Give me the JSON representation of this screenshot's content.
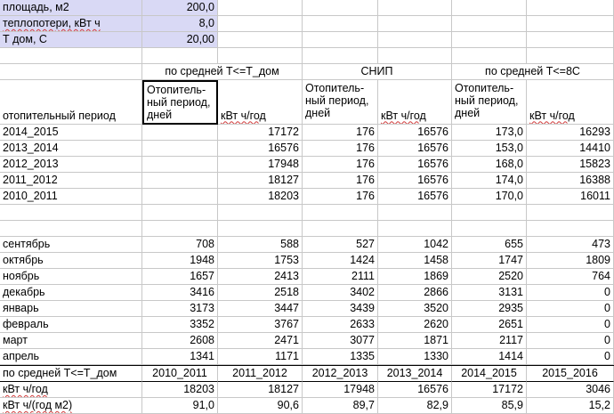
{
  "params": [
    {
      "label": "площадь, м2",
      "value": "200,0"
    },
    {
      "label": "теплопотери, кВт ч",
      "value": "8,0"
    },
    {
      "label": "Т дом, С",
      "value": "20,00"
    }
  ],
  "group_headers": [
    "по средней Т<=Т_дом",
    "СНИП",
    "по средней Т<=8С"
  ],
  "col_headers": {
    "period": "отопительный период",
    "days": "Отопитель-ный период, дней",
    "kwh": "кВт ч/год"
  },
  "seasons": [
    [
      "2014_2015",
      "",
      "17172",
      "176",
      "16576",
      "173,0",
      "16293"
    ],
    [
      "2013_2014",
      "",
      "16576",
      "176",
      "16576",
      "153,0",
      "14410"
    ],
    [
      "2012_2013",
      "",
      "17948",
      "176",
      "16576",
      "168,0",
      "15823"
    ],
    [
      "2011_2012",
      "",
      "18127",
      "176",
      "16576",
      "174,0",
      "16388"
    ],
    [
      "2010_2011",
      "",
      "18203",
      "176",
      "16576",
      "170,0",
      "16011"
    ]
  ],
  "months": [
    [
      "сентябрь",
      "708",
      "588",
      "527",
      "1042",
      "655",
      "473"
    ],
    [
      "октябрь",
      "1948",
      "1753",
      "1424",
      "1458",
      "1747",
      "1809"
    ],
    [
      "ноябрь",
      "1657",
      "2413",
      "2111",
      "1869",
      "2520",
      "764"
    ],
    [
      "декабрь",
      "3416",
      "2518",
      "3402",
      "2866",
      "3131",
      "0"
    ],
    [
      "январь",
      "3173",
      "3447",
      "3439",
      "3520",
      "2935",
      "0"
    ],
    [
      "февраль",
      "3352",
      "3767",
      "2633",
      "2620",
      "2651",
      "0"
    ],
    [
      "март",
      "2608",
      "2471",
      "3077",
      "1871",
      "2117",
      "0"
    ],
    [
      "апрель",
      "1341",
      "1171",
      "1335",
      "1330",
      "1414",
      "0"
    ]
  ],
  "summary_header": [
    "по средней Т<=Т_дом",
    "2010_2011",
    "2011_2012",
    "2012_2013",
    "2013_2014",
    "2014_2015",
    "2015_2016"
  ],
  "summary_rows": [
    [
      "кВт ч/год",
      "18203",
      "18127",
      "17948",
      "16576",
      "17172",
      "3046"
    ],
    [
      "кВт ч/(год м2)",
      "91,0",
      "90,6",
      "89,7",
      "82,9",
      "85,9",
      "15,2"
    ]
  ]
}
